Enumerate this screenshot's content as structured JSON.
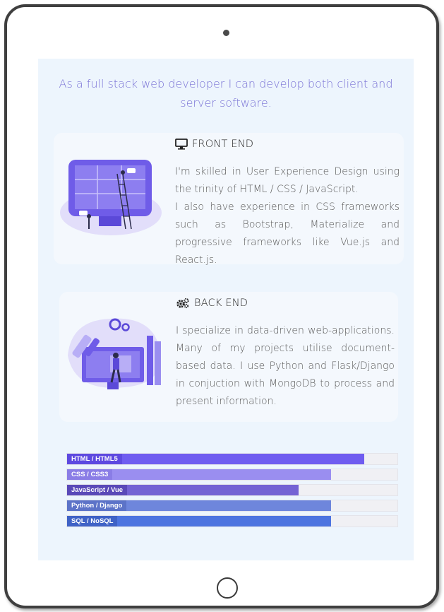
{
  "intro": "As a full stack web developer I can develop both client and server software.",
  "front_end": {
    "icon": "monitor-icon",
    "title": "FRONT END",
    "paragraphs": [
      "I'm skilled in User Experience Design using the trinity of HTML / CSS / JavaScript.",
      "I also have experience in CSS frameworks such as Bootstrap, Materialize and progressive frameworks like Vue.js and React.js."
    ]
  },
  "back_end": {
    "icon": "gears-icon",
    "title": "BACK END",
    "paragraphs": [
      "I specialize in data-driven web-applications. Many of my projects utilise document-based data. I use Python and Flask/Django in conjuction with MongoDB to process and present information."
    ]
  },
  "skills": [
    {
      "label": "HTML / HTML5",
      "percent": 90,
      "bar_color": "#6f5cf0",
      "label_color": "#5d49e0"
    },
    {
      "label": "CSS / CSS3",
      "percent": 80,
      "bar_color": "#9a8ef0",
      "label_color": "#8a7de6"
    },
    {
      "label": "JavaScript / Vue",
      "percent": 70,
      "bar_color": "#7463d4",
      "label_color": "#5a49b8"
    },
    {
      "label": "Python / Django",
      "percent": 80,
      "bar_color": "#6e86dc",
      "label_color": "#5c73c8"
    },
    {
      "label": "SQL / NoSQL",
      "percent": 80,
      "bar_color": "#4d74e0",
      "label_color": "#3f62c6"
    }
  ]
}
